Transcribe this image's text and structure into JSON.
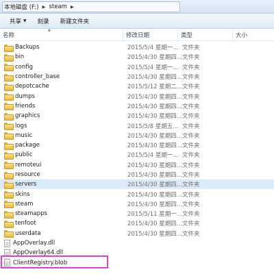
{
  "address": {
    "drive": "本地磁盘 (F:)",
    "folder": "steam"
  },
  "toolbar": {
    "share": "共享",
    "burn": "刻录",
    "new_folder": "新建文件夹"
  },
  "columns": {
    "name": "名称",
    "date": "修改日期",
    "type": "类型",
    "size": "大小"
  },
  "items": [
    {
      "name": "Backups",
      "date": "2015/5/4 星期一...",
      "type": "文件夹",
      "kind": "folder"
    },
    {
      "name": "bin",
      "date": "2015/4/30 星期四...",
      "type": "文件夹",
      "kind": "folder"
    },
    {
      "name": "config",
      "date": "2015/5/4 星期一...",
      "type": "文件夹",
      "kind": "folder"
    },
    {
      "name": "controller_base",
      "date": "2015/4/30 星期四...",
      "type": "文件夹",
      "kind": "folder"
    },
    {
      "name": "depotcache",
      "date": "2015/5/12 星期二...",
      "type": "文件夹",
      "kind": "folder"
    },
    {
      "name": "dumps",
      "date": "2015/4/30 星期四...",
      "type": "文件夹",
      "kind": "folder"
    },
    {
      "name": "friends",
      "date": "2015/4/30 星期四...",
      "type": "文件夹",
      "kind": "folder"
    },
    {
      "name": "graphics",
      "date": "2015/4/30 星期四...",
      "type": "文件夹",
      "kind": "folder"
    },
    {
      "name": "logs",
      "date": "2015/5/8 星期五...",
      "type": "文件夹",
      "kind": "folder"
    },
    {
      "name": "music",
      "date": "2015/4/30 星期四...",
      "type": "文件夹",
      "kind": "folder"
    },
    {
      "name": "package",
      "date": "2015/4/30 星期四...",
      "type": "文件夹",
      "kind": "folder"
    },
    {
      "name": "public",
      "date": "2015/5/4 星期一...",
      "type": "文件夹",
      "kind": "folder"
    },
    {
      "name": "remoteui",
      "date": "2015/4/30 星期四...",
      "type": "文件夹",
      "kind": "folder"
    },
    {
      "name": "resource",
      "date": "2015/4/30 星期四...",
      "type": "文件夹",
      "kind": "folder"
    },
    {
      "name": "servers",
      "date": "2015/4/30 星期四...",
      "type": "文件夹",
      "kind": "folder"
    },
    {
      "name": "skins",
      "date": "2015/4/30 星期四...",
      "type": "文件夹",
      "kind": "folder"
    },
    {
      "name": "steam",
      "date": "2015/4/30 星期四...",
      "type": "文件夹",
      "kind": "folder"
    },
    {
      "name": "steamapps",
      "date": "2015/5/11 星期一...",
      "type": "文件夹",
      "kind": "folder"
    },
    {
      "name": "tenfoot",
      "date": "2015/4/30 星期四...",
      "type": "文件夹",
      "kind": "folder"
    },
    {
      "name": "userdata",
      "date": "2015/4/30 星期四...",
      "type": "文件夹",
      "kind": "folder"
    },
    {
      "name": "AppOverlay.dll",
      "date": "",
      "type": "",
      "kind": "file"
    },
    {
      "name": "AppOverlay64.dll",
      "date": "",
      "type": "",
      "kind": "file"
    },
    {
      "name": "ClientRegistry.blob",
      "date": "",
      "type": "",
      "kind": "file"
    }
  ],
  "selected_row": 14,
  "highlight_color": "#e23bd6"
}
